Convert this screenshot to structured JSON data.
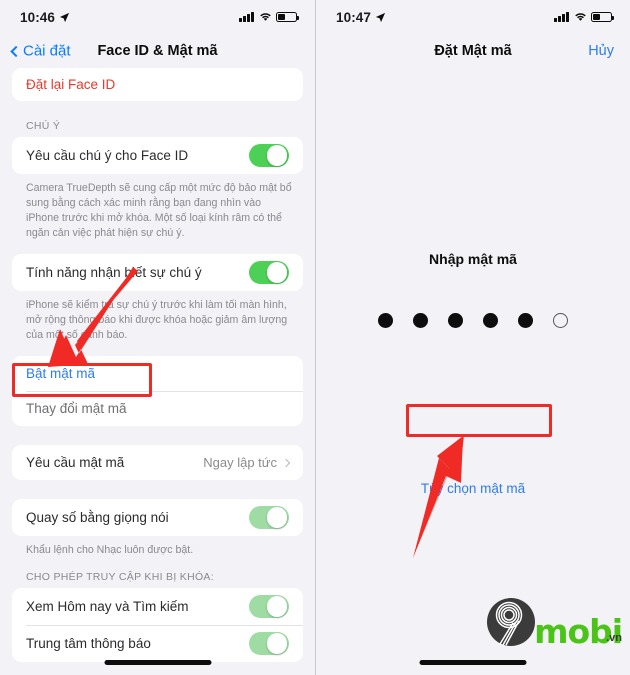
{
  "left": {
    "status": {
      "time": "10:46",
      "location_icon": "location-arrow-icon",
      "signal_icon": "cellular-bars-icon",
      "wifi_icon": "wifi-icon",
      "battery_icon": "battery-low-icon"
    },
    "nav": {
      "back_label": "Cài đặt",
      "title": "Face ID & Mật mã"
    },
    "reset_row": {
      "label": "Đặt lại Face ID"
    },
    "attention": {
      "header": "CHÚ Ý",
      "require_attention": {
        "label": "Yêu cầu chú ý cho Face ID",
        "toggle": "on"
      },
      "require_attention_footer": "Camera TrueDepth sẽ cung cấp một mức độ bảo mật bổ sung bằng cách xác minh rằng bạn đang nhìn vào iPhone trước khi mở khóa. Một số loại kính râm có thể ngăn cản việc phát hiện sự chú ý.",
      "attention_aware": {
        "label": "Tính năng nhận biết sự chú ý",
        "toggle": "on"
      },
      "attention_aware_footer": "iPhone sẽ kiểm tra sự chú ý trước khi làm tối màn hình, mở rộng thông báo khi được khóa hoặc giảm âm lượng của một số cảnh báo."
    },
    "passcode_group": {
      "turn_on": "Bật mật mã",
      "change": "Thay đổi mật mã"
    },
    "require_passcode": {
      "label": "Yêu cầu mật mã",
      "value": "Ngay lập tức",
      "chevron": "chevron-right-icon"
    },
    "voice_dial": {
      "label": "Quay số bằng giọng nói",
      "toggle": "on-faded",
      "footer": "Khẩu lệnh cho Nhạc luôn được bật."
    },
    "allow_access": {
      "header": "CHO PHÉP TRUY CẬP KHI BỊ KHÓA:",
      "items": [
        {
          "label": "Xem Hôm nay và Tìm kiếm",
          "toggle": "on-faded"
        },
        {
          "label": "Trung tâm thông báo",
          "toggle": "on-faded"
        }
      ]
    }
  },
  "right": {
    "status": {
      "time": "10:47",
      "location_icon": "location-arrow-icon",
      "signal_icon": "cellular-bars-icon",
      "wifi_icon": "wifi-icon",
      "battery_icon": "battery-low-icon"
    },
    "nav": {
      "title": "Đặt Mật mã",
      "cancel_label": "Hủy"
    },
    "prompt": "Nhập mật mã",
    "dots_total": 6,
    "dots_filled": 5,
    "options_label": "Tùy chọn mật mã"
  },
  "watermark": {
    "digit": "9",
    "name": "mobi",
    "tld": ".vn"
  },
  "colors": {
    "accent_blue": "#2f7dea",
    "destructive_red": "#e8392a",
    "toggle_green": "#4cd055",
    "toggle_green_faded": "#9edca4",
    "annotation_red": "#f02a25",
    "screen_bg": "#f2f2f7",
    "logo_green": "#4cc417"
  }
}
